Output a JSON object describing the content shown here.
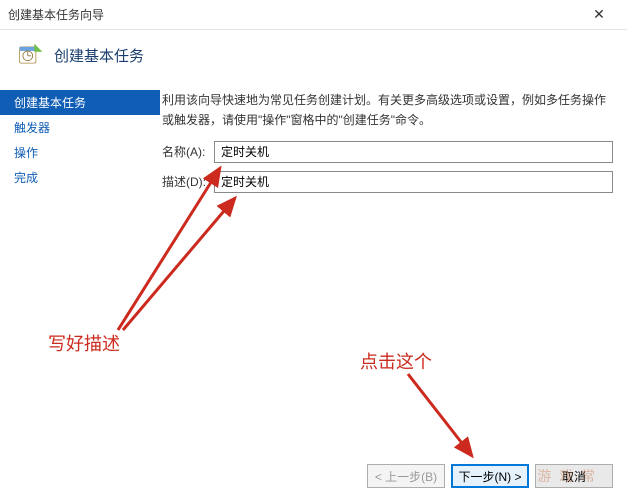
{
  "window": {
    "title": "创建基本任务向导",
    "close": "✕"
  },
  "header": {
    "title": "创建基本任务"
  },
  "sidebar": {
    "items": [
      {
        "label": "创建基本任务"
      },
      {
        "label": "触发器"
      },
      {
        "label": "操作"
      },
      {
        "label": "完成"
      }
    ]
  },
  "main": {
    "intro": "利用该向导快速地为常见任务创建计划。有关更多高级选项或设置，例如多任务操作或触发器，请使用\"操作\"窗格中的\"创建任务\"命令。",
    "name_label": "名称(A):",
    "name_value": "定时关机",
    "desc_label": "描述(D):",
    "desc_value": "定时关机"
  },
  "footer": {
    "back": "< 上一步(B)",
    "next": "下一步(N) >",
    "cancel": "取消"
  },
  "annotations": {
    "left": "写好描述",
    "right": "点击这个"
  },
  "watermark": "游 戏 常"
}
